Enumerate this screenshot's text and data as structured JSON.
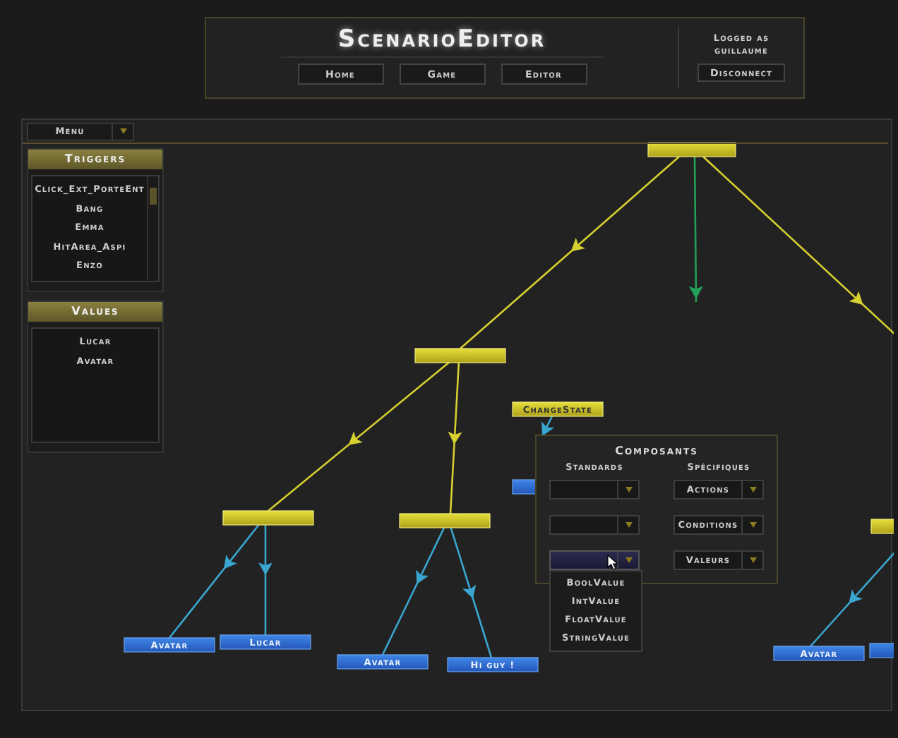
{
  "header": {
    "title": "ScenarioEditor",
    "nav": [
      {
        "label": "Home"
      },
      {
        "label": "Game"
      },
      {
        "label": "Editor"
      }
    ],
    "user": {
      "status": "Logged as",
      "name": "guillaume"
    },
    "disconnect": "Disconnect"
  },
  "menu": {
    "label": "Menu"
  },
  "triggers": {
    "title": "Triggers",
    "items": [
      "Click_Ext_PorteEnt",
      "Bang",
      "Emma",
      "HitArea_Aspi",
      "Enzo"
    ]
  },
  "values": {
    "title": "Values",
    "items": [
      "Lucar",
      "Avatar"
    ]
  },
  "graph": {
    "nodes": [
      {
        "kind": "action"
      },
      {
        "kind": "action"
      },
      {
        "kind": "action",
        "label": "ChangeState"
      },
      {
        "kind": "action"
      },
      {
        "kind": "action"
      },
      {
        "kind": "action"
      },
      {
        "kind": "value",
        "label": "Avatar"
      },
      {
        "kind": "value",
        "label": "Lucar"
      },
      {
        "kind": "value",
        "label": "Avatar"
      },
      {
        "kind": "value",
        "label": "Hi guy !"
      },
      {
        "kind": "value",
        "label": "Avatar"
      },
      {
        "kind": "value"
      },
      {
        "kind": "value"
      }
    ],
    "edges": [
      {
        "color": "#d6d030"
      },
      {
        "color": "#22a058"
      },
      {
        "color": "#d6d030"
      },
      {
        "color": "#d6d030"
      },
      {
        "color": "#d6d030"
      },
      {
        "color": "#3aa6d0"
      },
      {
        "color": "#3aa6d0"
      },
      {
        "color": "#3aa6d0"
      },
      {
        "color": "#3aa6d0"
      },
      {
        "color": "#3aa6d0"
      },
      {
        "color": "#3aa6d0"
      }
    ]
  },
  "composants": {
    "title": "Composants",
    "standards": {
      "title": "Standards",
      "dropdowns": [
        {
          "expanded": false
        },
        {
          "expanded": false
        },
        {
          "expanded": true
        }
      ],
      "options": [
        "BoolValue",
        "IntValue",
        "FloatValue",
        "StringValue"
      ]
    },
    "specifiques": {
      "title": "Spécifiques",
      "dropdowns": [
        {
          "label": "Actions"
        },
        {
          "label": "Conditions"
        },
        {
          "label": "Valeurs"
        }
      ]
    }
  }
}
